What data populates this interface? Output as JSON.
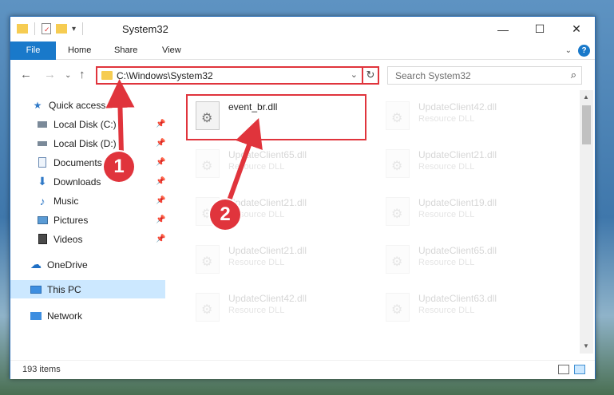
{
  "window": {
    "title": "System32",
    "controls": {
      "minimize": "—",
      "maximize": "☐",
      "close": "✕"
    }
  },
  "ribbon": {
    "tabs": [
      "File",
      "Home",
      "Share",
      "View"
    ]
  },
  "address": {
    "path": "C:\\Windows\\System32",
    "search_placeholder": "Search System32"
  },
  "sidebar": {
    "items": [
      {
        "label": "Quick access",
        "icon": "star-icon",
        "pinned": false
      },
      {
        "label": "Local Disk (C:)",
        "icon": "drive-icon",
        "pinned": true
      },
      {
        "label": "Local Disk (D:)",
        "icon": "drive-icon",
        "pinned": true
      },
      {
        "label": "Documents",
        "icon": "documents-icon",
        "pinned": true
      },
      {
        "label": "Downloads",
        "icon": "download-icon",
        "pinned": true
      },
      {
        "label": "Music",
        "icon": "music-icon",
        "pinned": true
      },
      {
        "label": "Pictures",
        "icon": "pictures-icon",
        "pinned": true
      },
      {
        "label": "Videos",
        "icon": "videos-icon",
        "pinned": true
      },
      {
        "label": "OneDrive",
        "icon": "cloud-icon",
        "pinned": false
      },
      {
        "label": "This PC",
        "icon": "computer-icon",
        "pinned": false
      },
      {
        "label": "Network",
        "icon": "network-icon",
        "pinned": false
      }
    ]
  },
  "files": {
    "highlighted": {
      "name": "event_br.dll"
    },
    "items": [
      {
        "name": "UpdateClient42.dll",
        "type": "Resource DLL"
      },
      {
        "name": "UpdateClient65.dll",
        "type": "Resource DLL"
      },
      {
        "name": "UpdateClient21.dll",
        "type": "Resource DLL"
      },
      {
        "name": "UpdateClient21.dll",
        "type": "Resource DLL"
      },
      {
        "name": "UpdateClient19.dll",
        "type": "Resource DLL"
      },
      {
        "name": "UpdateClient21.dll",
        "type": "Resource DLL"
      },
      {
        "name": "UpdateClient65.dll",
        "type": "Resource DLL"
      },
      {
        "name": "UpdateClient42.dll",
        "type": "Resource DLL"
      },
      {
        "name": "UpdateClient63.dll",
        "type": "Resource DLL"
      }
    ]
  },
  "status": {
    "item_count": "193 items"
  },
  "annotations": {
    "callout_1": "1",
    "callout_2": "2"
  },
  "colors": {
    "accent": "#1979ca",
    "highlight": "#e0343c",
    "selected": "#cce8ff"
  }
}
